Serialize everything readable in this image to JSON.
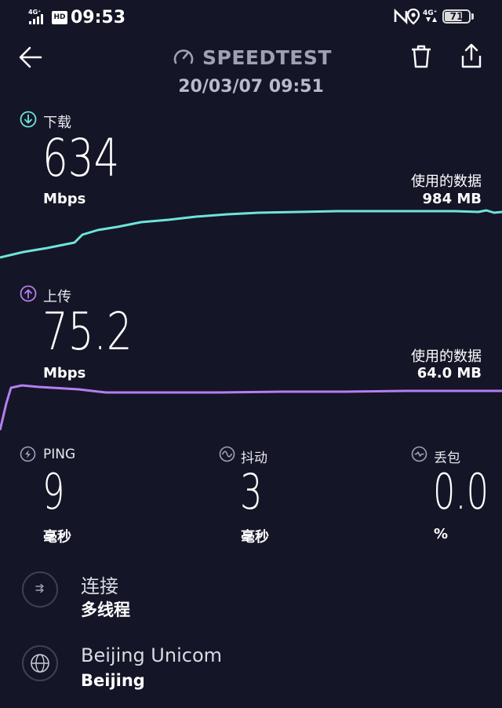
{
  "status_bar": {
    "time": "09:53",
    "network_left": "4G⁺",
    "hd": "HD",
    "network_right": "4G⁺",
    "battery": "71"
  },
  "header": {
    "title": "SPEEDTEST",
    "datetime": "20/03/07 09:51"
  },
  "download": {
    "label": "下载",
    "value": "634",
    "unit": "Mbps",
    "data_used_label": "使用的数据",
    "data_used": "984 MB",
    "color": "#6ee4dc"
  },
  "upload": {
    "label": "上传",
    "value": "75.2",
    "unit": "Mbps",
    "data_used_label": "使用的数据",
    "data_used": "64.0 MB",
    "color": "#b47ff0"
  },
  "metrics": {
    "ping": {
      "label": "PING",
      "value": "9",
      "unit": "毫秒"
    },
    "jitter": {
      "label": "抖动",
      "value": "3",
      "unit": "毫秒"
    },
    "loss": {
      "label": "丢包",
      "value": "0.0",
      "unit": "%"
    }
  },
  "connection": {
    "title": "连接",
    "value": "多线程"
  },
  "provider": {
    "name": "Beijing Unicom",
    "location": "Beijing"
  }
}
